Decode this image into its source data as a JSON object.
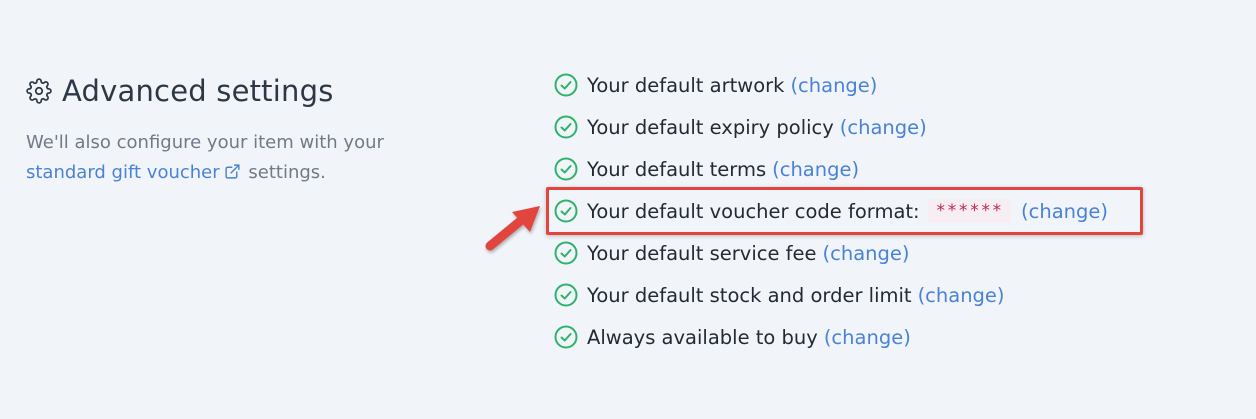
{
  "section": {
    "title": "Advanced settings",
    "icon": "gear-icon",
    "description_prefix": "We'll also configure your item with your",
    "link_text": "standard gift voucher",
    "link_icon": "external-link-icon",
    "description_suffix": "settings."
  },
  "settings": [
    {
      "label": "Your default artwork",
      "action": "(change)"
    },
    {
      "label": "Your default expiry policy",
      "action": "(change)"
    },
    {
      "label": "Your default terms",
      "action": "(change)"
    },
    {
      "label": "Your default voucher code format:",
      "code": "******",
      "action": "(change)"
    },
    {
      "label": "Your default service fee",
      "action": "(change)"
    },
    {
      "label": "Your default stock and order limit",
      "action": "(change)"
    },
    {
      "label": "Always available to buy",
      "action": "(change)"
    }
  ],
  "colors": {
    "check": "#2fb36b",
    "link": "#4a82d6",
    "highlight": "#e2453e",
    "code": "#c3284a"
  }
}
